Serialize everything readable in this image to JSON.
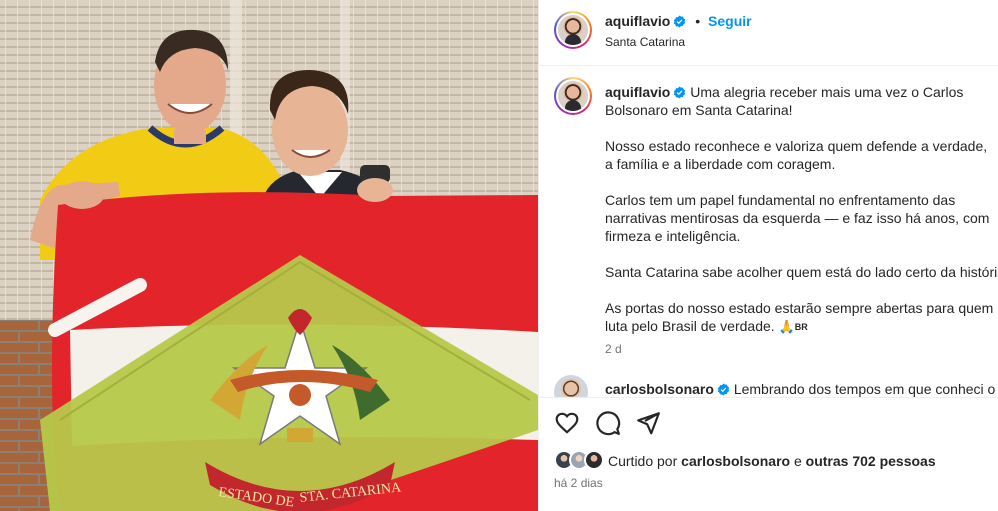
{
  "header": {
    "username": "aquiflavio",
    "separator": "•",
    "follow_label": "Seguir",
    "location": "Santa Catarina"
  },
  "caption": {
    "username": "aquiflavio",
    "paragraphs": [
      "Uma alegria receber mais uma vez o Carlos Bolsonaro em Santa Catarina!",
      "Nosso estado reconhece e valoriza quem defende a verdade, a família e a liberdade com coragem.",
      "Carlos tem um papel fundamental no enfrentamento das narrativas mentirosas da esquerda — e faz isso há anos, com firmeza e inteligência.",
      "Santa Catarina sabe acolher quem está do lado certo da história.",
      "As portas do nosso estado estarão sempre abertas para quem luta pelo Brasil de verdade."
    ],
    "emoji": "🙏",
    "flag_label": "BR",
    "time_ago": "2 d"
  },
  "comment": {
    "username": "carlosbolsonaro",
    "text": "Lembrando dos tempos em que conheci o"
  },
  "likes": {
    "prefix": "Curtido por",
    "user": "carlosbolsonaro",
    "middle": "e",
    "others": "outras 702 pessoas"
  },
  "posted": "há 2 dias",
  "icons": {
    "like": "heart-outline-icon",
    "comment": "comment-bubble-icon",
    "share": "paper-plane-icon",
    "verified": "verified-badge-icon"
  },
  "colors": {
    "follow": "#0095f6",
    "verified": "#0095f6",
    "secondary_text": "#737373",
    "flag_red": "#e3242b",
    "flag_green": "#b6c84a"
  },
  "photo": {
    "seal_text": "ESTADO DE SANTA CATARINA",
    "seal_text_left": "ESTADO DE",
    "seal_text_right": "STA. CATARINA"
  }
}
